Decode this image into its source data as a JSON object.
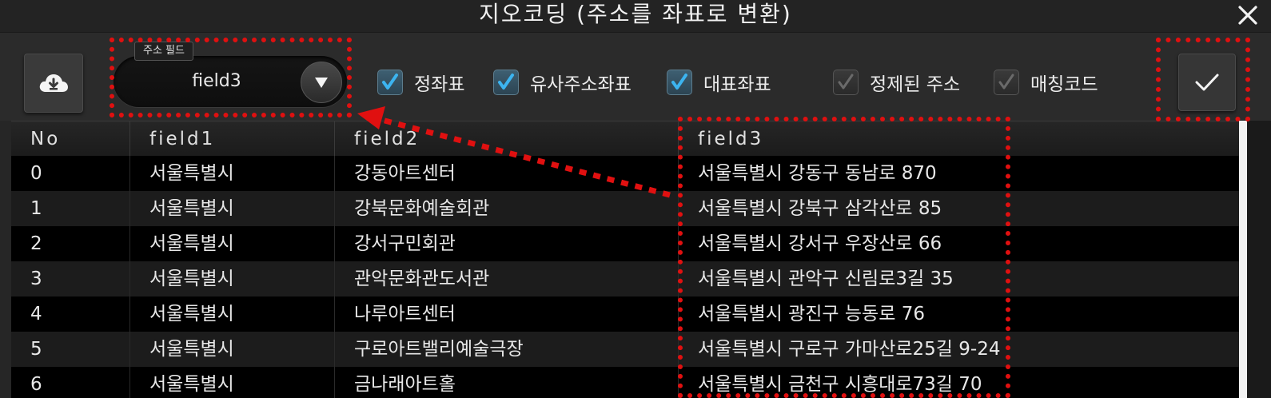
{
  "window": {
    "title": "지오코딩 (주소를 좌표로 변환)"
  },
  "toolbar": {
    "field_select_label": "주소 필드",
    "field_select_value": "field3",
    "checkboxes": [
      {
        "label": "정좌표",
        "checked": true
      },
      {
        "label": "유사주소좌표",
        "checked": true
      },
      {
        "label": "대표좌표",
        "checked": true
      },
      {
        "label": "정제된 주소",
        "checked": false
      },
      {
        "label": "매칭코드",
        "checked": false
      }
    ]
  },
  "table": {
    "headers": [
      "No",
      "field1",
      "field2",
      "field3"
    ],
    "rows": [
      [
        "0",
        "서울특별시",
        "강동아트센터",
        "서울특별시 강동구 동남로 870"
      ],
      [
        "1",
        "서울특별시",
        "강북문화예술회관",
        "서울특별시 강북구 삼각산로 85"
      ],
      [
        "2",
        "서울특별시",
        "강서구민회관",
        "서울특별시 강서구 우장산로 66"
      ],
      [
        "3",
        "서울특별시",
        "관악문화관도서관",
        "서울특별시 관악구 신림로3길 35"
      ],
      [
        "4",
        "서울특별시",
        "나루아트센터",
        "서울특별시 광진구 능동로 76"
      ],
      [
        "5",
        "서울특별시",
        "구로아트밸리예술극장",
        "서울특별시 구로구 가마산로25길 9-24"
      ],
      [
        "6",
        "서울특별시",
        "금나래아트홀",
        "서울특별시 금천구 시흥대로73길 70"
      ]
    ]
  },
  "colors": {
    "highlight": "#e01010",
    "checkbox_on": "#3e5f72",
    "check_mark": "#3cb4f0"
  }
}
